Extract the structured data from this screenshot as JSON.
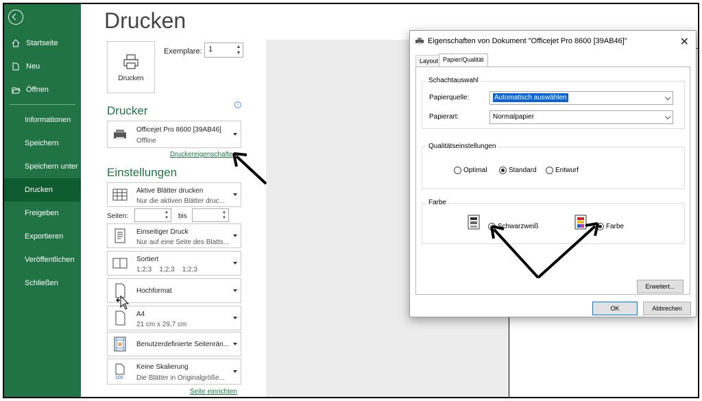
{
  "sidebar": {
    "back_icon": "back-arrow-icon",
    "top_items": [
      {
        "label": "Startseite",
        "icon": "home-icon"
      },
      {
        "label": "Neu",
        "icon": "new-file-icon"
      },
      {
        "label": "Öffnen",
        "icon": "folder-open-icon"
      }
    ],
    "items": [
      {
        "label": "Informationen"
      },
      {
        "label": "Speichern"
      },
      {
        "label": "Speichern unter"
      },
      {
        "label": "Drucken",
        "active": true
      },
      {
        "label": "Freigeben"
      },
      {
        "label": "Exportieren"
      },
      {
        "label": "Veröffentlichen"
      },
      {
        "label": "Schließen"
      }
    ],
    "bg_color": "#217346"
  },
  "print": {
    "title": "Drucken",
    "print_button_label": "Drucken",
    "copies_label": "Exemplare:",
    "copies_value": "1"
  },
  "printer": {
    "heading": "Drucker",
    "name": "Officejet Pro 8600 [39AB46]",
    "status": "Offline",
    "properties_link": "Druckereigenschaften"
  },
  "settings": {
    "heading": "Einstellungen",
    "what": {
      "main": "Aktive Blätter drucken",
      "sub": "Nur die aktiven Blätter druc..."
    },
    "pages_label": "Seiten:",
    "to_label": "bis",
    "sides": {
      "main": "Einseitiger Druck",
      "sub": "Nur auf eine Seite des Blatts..."
    },
    "collate": {
      "main": "Sortiert",
      "sub": "1;2;3    1;2;3    1;2;3"
    },
    "orientation": {
      "main": "Hochformat"
    },
    "paper": {
      "main": "A4",
      "sub": "21 cm x 29,7 cm"
    },
    "margins": {
      "main": "Benutzerdefinierte Seitenrän..."
    },
    "scaling": {
      "main": "Keine Skalierung",
      "sub": "Die Blätter in Originalgröße..."
    },
    "page_setup_link": "Seite einrichten"
  },
  "dialog": {
    "title": "Eigenschaften von Dokument \"Officejet Pro 8600 [39AB46]\"",
    "tabs": [
      "Layout",
      "Papier/Qualität"
    ],
    "active_tab": 1,
    "tray_group": "Schachtauswahl",
    "paper_source_label": "Papierquelle:",
    "paper_source_value": "Automatisch auswählen",
    "paper_type_label": "Papierart:",
    "paper_type_value": "Normalpapier",
    "quality_group": "Qualitätseinstellungen",
    "quality_options": [
      "Optimal",
      "Standard",
      "Entwurf"
    ],
    "quality_selected": "Standard",
    "color_group": "Farbe",
    "color_options": [
      "Schwarzweiß",
      "Farbe"
    ],
    "color_selected": "Farbe",
    "advanced_button": "Erweitert...",
    "ok_button": "OK",
    "cancel_button": "Abbrechen"
  }
}
